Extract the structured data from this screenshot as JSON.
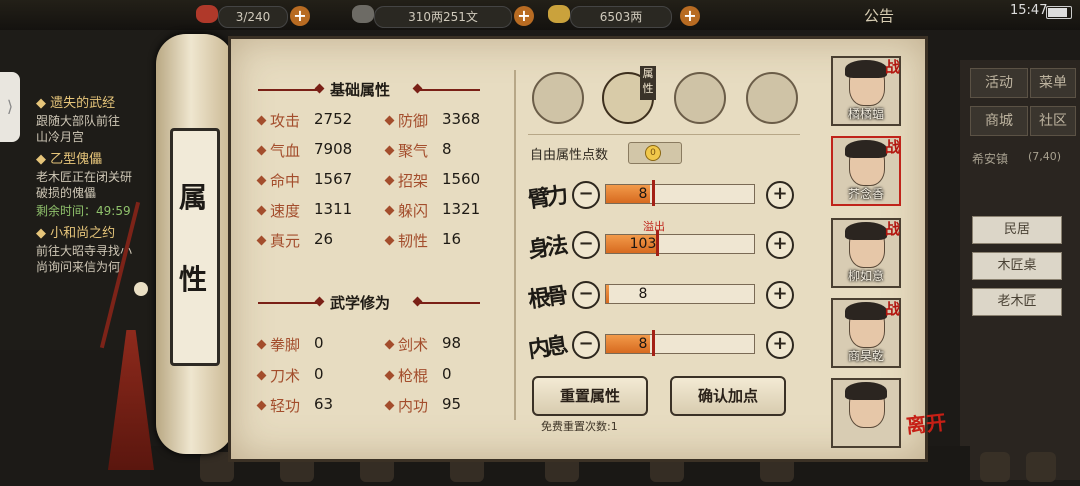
{
  "topbar": {
    "stamina": "3/240",
    "copper": "310两251文",
    "silver": "6503两",
    "notice": "公告",
    "time": "15:47"
  },
  "quests": [
    {
      "title": "遗失的武经",
      "lines": [
        "跟随大部队前往",
        "山冷月宫"
      ]
    },
    {
      "title": "乙型傀儡",
      "lines": [
        "老木匠正在闭关研",
        "破损的傀儡"
      ],
      "timer": "剩余时间：49:59"
    },
    {
      "title": "小和尚之约",
      "lines": [
        "前往大昭寺寻找小",
        "尚询问来信为何"
      ]
    }
  ],
  "right_menu": {
    "buttons": [
      "活动",
      "菜单",
      "商城",
      "社区"
    ],
    "location": "希安镇",
    "coords": "(7,40)",
    "buildings": [
      "民居",
      "木匠桌",
      "老木匠"
    ]
  },
  "scroll_label": [
    "属",
    "性"
  ],
  "basic": {
    "title": "基础属性",
    "attrs": [
      {
        "name": "攻击",
        "value": "2752"
      },
      {
        "name": "防御",
        "value": "3368"
      },
      {
        "name": "气血",
        "value": "7908"
      },
      {
        "name": "聚气",
        "value": "8"
      },
      {
        "name": "命中",
        "value": "1567"
      },
      {
        "name": "招架",
        "value": "1560"
      },
      {
        "name": "速度",
        "value": "1311"
      },
      {
        "name": "躲闪",
        "value": "1321"
      },
      {
        "name": "真元",
        "value": "26"
      },
      {
        "name": "韧性",
        "value": "16"
      }
    ]
  },
  "martial": {
    "title": "武学修为",
    "attrs": [
      {
        "name": "拳脚",
        "value": "0"
      },
      {
        "name": "剑术",
        "value": "98"
      },
      {
        "name": "刀术",
        "value": "0"
      },
      {
        "name": "枪棍",
        "value": "0"
      },
      {
        "name": "轻功",
        "value": "63"
      },
      {
        "name": "内功",
        "value": "95"
      }
    ]
  },
  "tabs": {
    "icons": [
      "character-portrait-icon",
      "scroll-attributes-icon",
      "bagua-icon",
      "anatomy-icon"
    ],
    "active_flag": "属性"
  },
  "points": {
    "label": "自由属性点数",
    "value": "0"
  },
  "stats": [
    {
      "name": "臂力",
      "value": "8",
      "fill": 0.3
    },
    {
      "name": "身法",
      "value": "103",
      "fill": 0.35,
      "overflow": "溢出"
    },
    {
      "name": "根骨",
      "value": "8",
      "fill": 0.02
    },
    {
      "name": "内息",
      "value": "8",
      "fill": 0.3
    }
  ],
  "actions": {
    "reset": "重置属性",
    "confirm": "确认加点",
    "free_reset": "免费重置次数:1"
  },
  "party": [
    {
      "name": "橘橘蝠",
      "tag": "战"
    },
    {
      "name": "芥念香",
      "tag": "战"
    },
    {
      "name": "柳如意",
      "tag": "战"
    },
    {
      "name": "商昊乾",
      "tag": "战"
    },
    {
      "name": "",
      "tag": ""
    }
  ],
  "leave": "离开",
  "colors": {
    "accent": "#a34d2c",
    "bar": "#e07a2a",
    "parchment": "#e7dcc1",
    "overflow": "#c0231a"
  }
}
